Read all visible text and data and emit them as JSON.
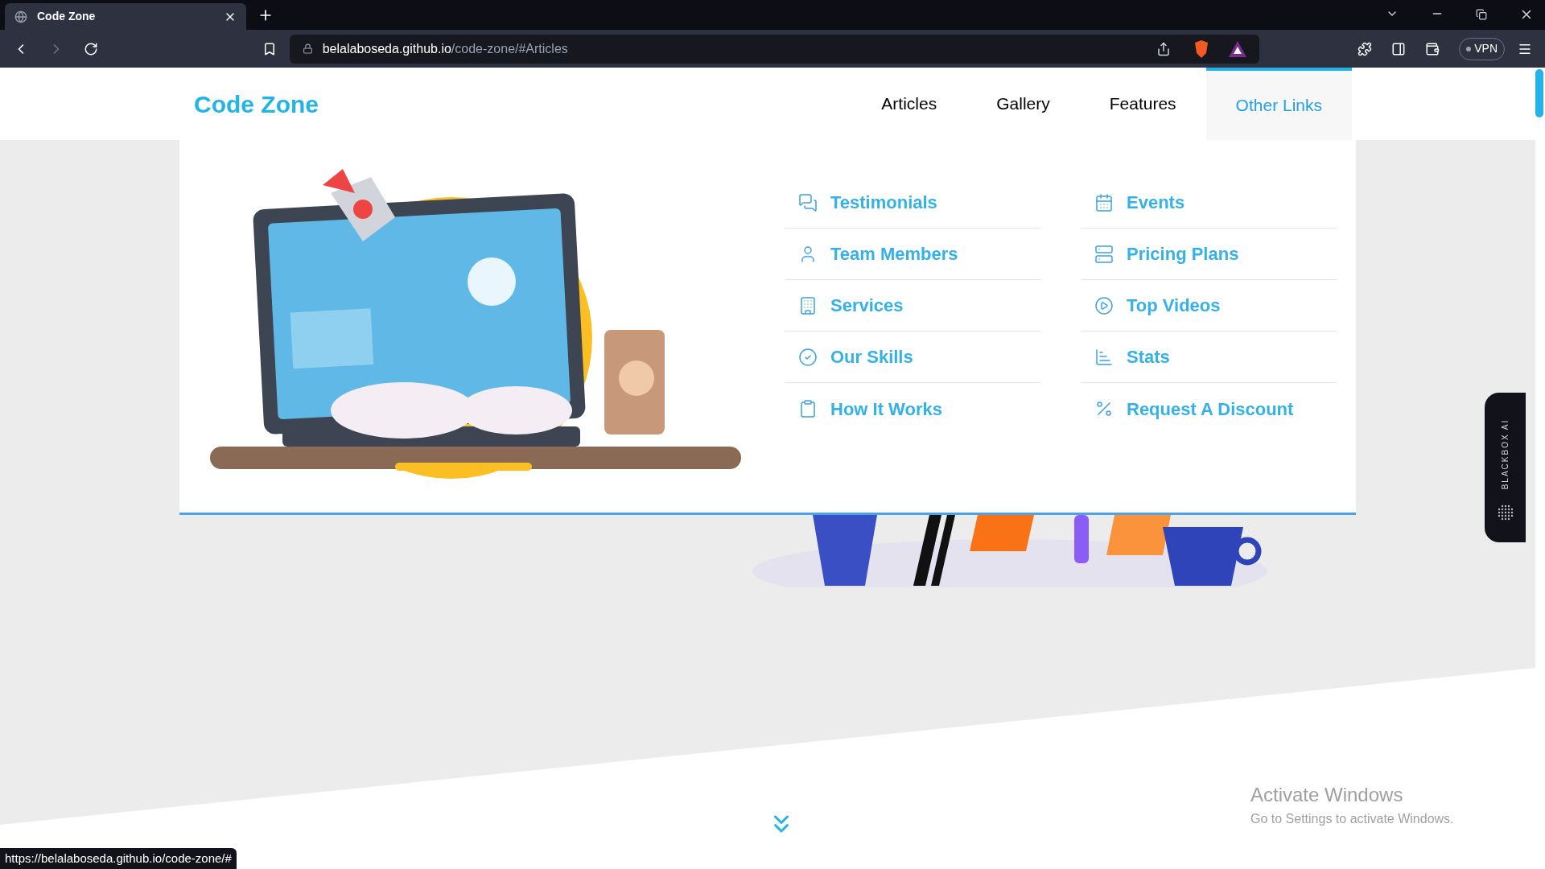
{
  "browser": {
    "tab_title": "Code Zone",
    "url_host": "belalaboseda.github.io",
    "url_path": "/code-zone/#Articles",
    "vpn_label": "VPN"
  },
  "site": {
    "logo": "Code Zone",
    "nav": [
      {
        "label": "Articles",
        "selected": false
      },
      {
        "label": "Gallery",
        "selected": false
      },
      {
        "label": "Features",
        "selected": false
      },
      {
        "label": "Other Links",
        "selected": true
      }
    ]
  },
  "mega_menu": {
    "columns": [
      [
        {
          "label": "Testimonials"
        },
        {
          "label": "Team Members"
        },
        {
          "label": "Services"
        },
        {
          "label": "Our Skills"
        },
        {
          "label": "How It Works"
        }
      ],
      [
        {
          "label": "Events"
        },
        {
          "label": "Pricing Plans"
        },
        {
          "label": "Top Videos"
        },
        {
          "label": "Stats"
        },
        {
          "label": "Request A Discount"
        }
      ]
    ]
  },
  "side_tab": {
    "label": "BLACKBOX AI"
  },
  "activation_notice": {
    "title": "Activate Windows",
    "text": "Go to Settings to activate Windows."
  },
  "status_bar": {
    "url": "https://belalaboseda.github.io/code-zone/#"
  }
}
